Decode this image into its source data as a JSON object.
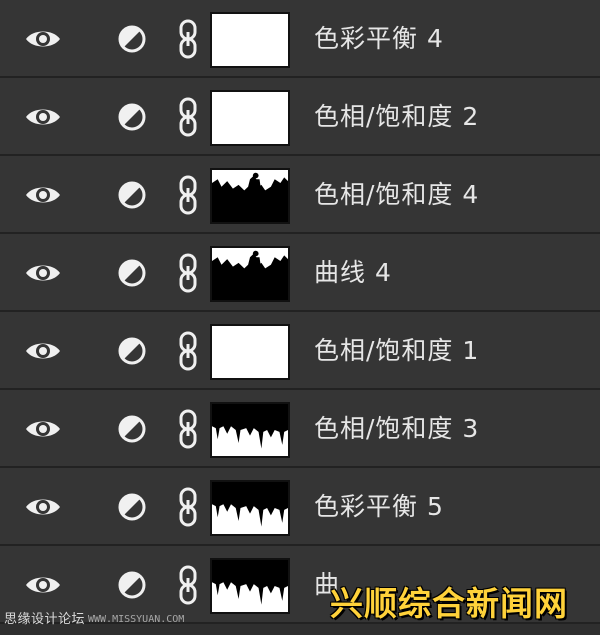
{
  "layers": [
    {
      "name": "色彩平衡 4",
      "mask": "white"
    },
    {
      "name": "色相/饱和度 2",
      "mask": "white"
    },
    {
      "name": "色相/饱和度 4",
      "mask": "silhouette-figure"
    },
    {
      "name": "曲线 4",
      "mask": "silhouette-figure"
    },
    {
      "name": "色相/饱和度 1",
      "mask": "white"
    },
    {
      "name": "色相/饱和度 3",
      "mask": "drips"
    },
    {
      "name": "色彩平衡 5",
      "mask": "drips"
    },
    {
      "name": "曲",
      "mask": "drips"
    }
  ],
  "icons": {
    "visibility": "eye-icon",
    "adjustment": "adjustment-layer-icon",
    "link": "chain-link-icon"
  },
  "watermark": {
    "left_text": "思缘设计论坛",
    "url_text": "WWW.MISSYUAN.COM",
    "right_text": "兴顺综合新闻网"
  },
  "colors": {
    "panel_bg": "#353535",
    "separator": "#222222",
    "text": "#e6e6e6",
    "watermark_yellow": "#ffd23a"
  }
}
